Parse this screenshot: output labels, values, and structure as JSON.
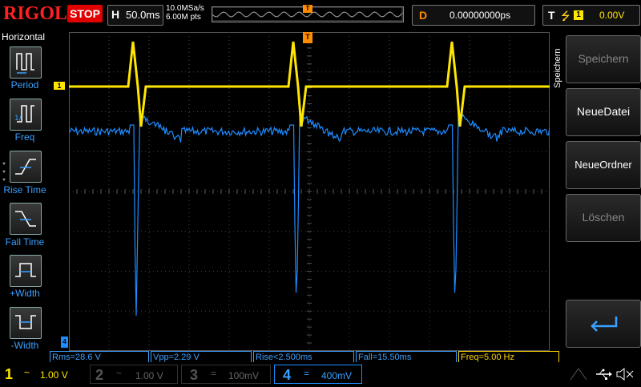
{
  "header": {
    "brand": "RIGOL",
    "run_state": "STOP",
    "timebase_label": "H",
    "timebase_value": "50.0ms",
    "sample_rate": "10.0MSa/s",
    "memory_depth": "6.00M pts",
    "trigger_pos_marker": "T",
    "delay_label": "D",
    "delay_value": "0.00000000ps",
    "trigger_label": "T",
    "trigger_source": "1",
    "trigger_level": "0.00V"
  },
  "left_panel": {
    "title": "Horizontal",
    "items": [
      {
        "label": "Period",
        "icon": "period-icon"
      },
      {
        "label": "Freq",
        "icon": "frequency-icon"
      },
      {
        "label": "Rise Time",
        "icon": "rise-time-icon"
      },
      {
        "label": "Fall Time",
        "icon": "fall-time-icon"
      },
      {
        "label": "+Width",
        "icon": "positive-width-icon"
      },
      {
        "label": "-Width",
        "icon": "negative-width-icon"
      }
    ]
  },
  "right_panel": {
    "title": "Speichern",
    "buttons": [
      {
        "label": "Speichern",
        "enabled": false
      },
      {
        "label": "NeueDatei",
        "enabled": true
      },
      {
        "label": "NeueOrdner",
        "enabled": true
      },
      {
        "label": "Löschen",
        "enabled": false
      },
      {
        "label": "",
        "icon": "return-arrow-icon"
      }
    ]
  },
  "ch1_marker": "1",
  "ch4_ground_marker": "4",
  "measurements": [
    {
      "text": "Rms=28.6 V",
      "channel": 4
    },
    {
      "text": "Vpp=2.29 V",
      "channel": 4
    },
    {
      "text": "Rise<2.500ms",
      "channel": 4
    },
    {
      "text": "Fall=15.50ms",
      "channel": 4
    },
    {
      "text": "Freq=5.00 Hz",
      "channel": 1
    }
  ],
  "channels": [
    {
      "num": "1",
      "coupling": "~",
      "scale": "1.00 V",
      "color": "#ffe600",
      "active": true
    },
    {
      "num": "2",
      "coupling": "~",
      "scale": "1.00 V",
      "color": "#666666",
      "active": false
    },
    {
      "num": "3",
      "coupling": "=",
      "scale": "100mV",
      "color": "#666666",
      "active": false
    },
    {
      "num": "4",
      "coupling": "=",
      "scale": "400mV",
      "color": "#2a8cff",
      "active": true
    }
  ],
  "colors": {
    "ch1": "#ffe600",
    "ch4": "#1e8cff",
    "trigger": "#ff8c00",
    "stop": "#e00000"
  }
}
